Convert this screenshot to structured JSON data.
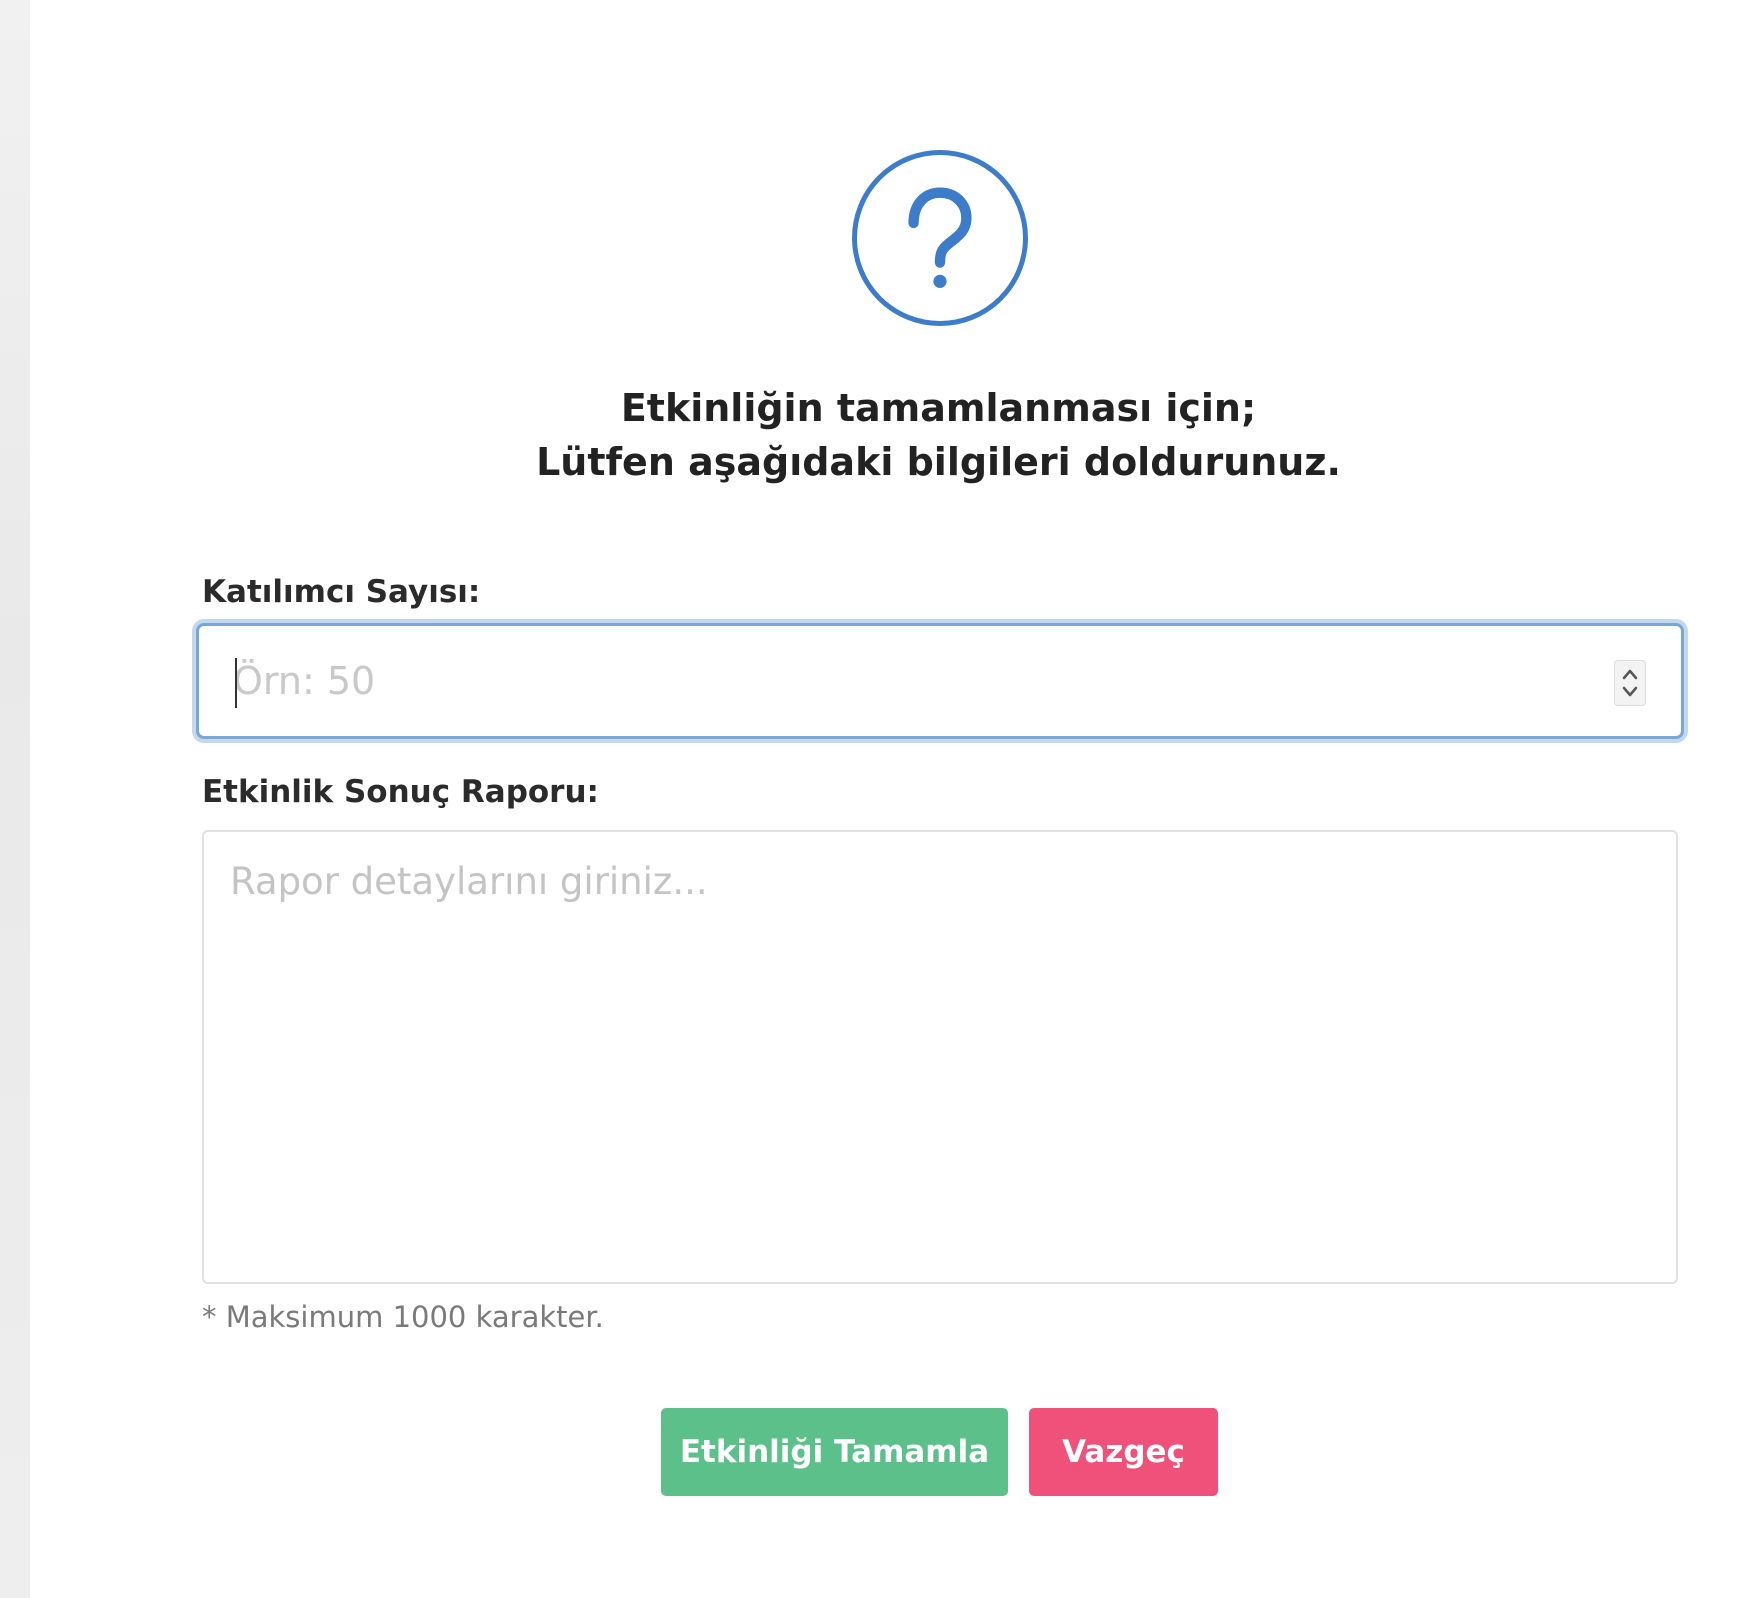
{
  "dialog": {
    "icon": "question-mark-icon",
    "title_line1": "Etkinliğin tamamlanması için;",
    "title_line2": "Lütfen aşağıdaki bilgileri doldurunuz."
  },
  "participants": {
    "label": "Katılımcı Sayısı:",
    "placeholder": "Örn: 50",
    "value": ""
  },
  "report": {
    "label": "Etkinlik Sonuç Raporu:",
    "placeholder": "Rapor detaylarını giriniz...",
    "value": "",
    "hint": "* Maksimum 1000 karakter."
  },
  "actions": {
    "complete_label": "Etkinliği Tamamla",
    "cancel_label": "Vazgeç"
  },
  "colors": {
    "icon_blue": "#3d7cc9",
    "focus_blue": "#7aa7d6",
    "complete_green": "#5cc08b",
    "cancel_pink": "#f0517a"
  }
}
